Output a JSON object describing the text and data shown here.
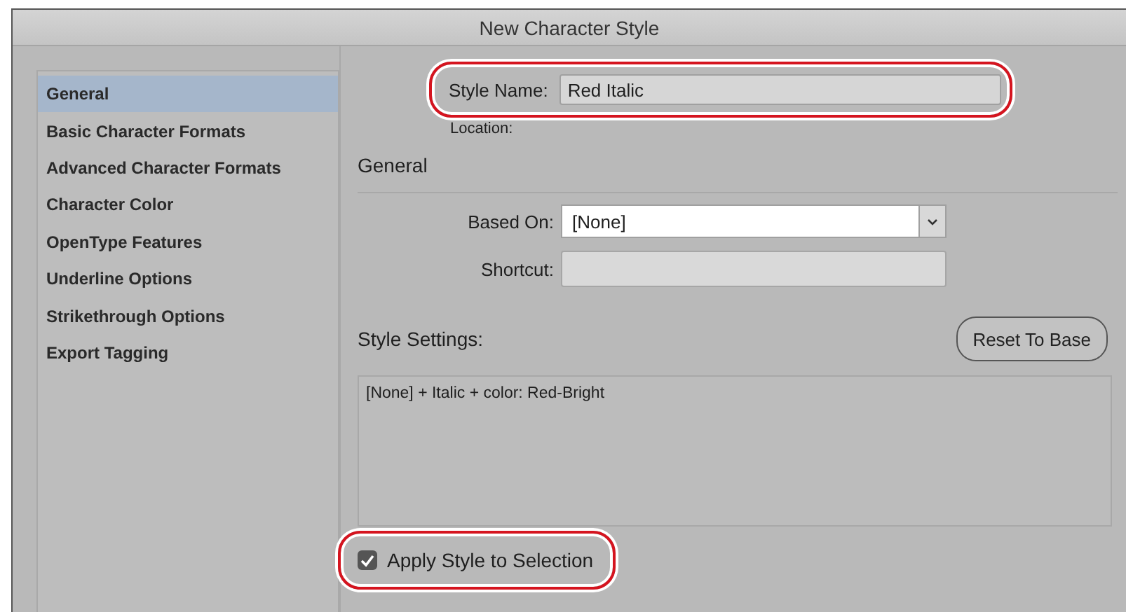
{
  "window": {
    "title": "New Character Style"
  },
  "sidebar": {
    "items": [
      {
        "label": "General",
        "selected": true
      },
      {
        "label": "Basic Character Formats",
        "selected": false
      },
      {
        "label": "Advanced Character Formats",
        "selected": false
      },
      {
        "label": "Character Color",
        "selected": false
      },
      {
        "label": "OpenType Features",
        "selected": false
      },
      {
        "label": "Underline Options",
        "selected": false
      },
      {
        "label": "Strikethrough Options",
        "selected": false
      },
      {
        "label": "Export Tagging",
        "selected": false
      }
    ]
  },
  "style_name": {
    "label": "Style Name:",
    "value": "Red Italic",
    "highlighted": true
  },
  "location": {
    "label": "Location:"
  },
  "section_title": "General",
  "based_on": {
    "label": "Based On:",
    "value": "[None]"
  },
  "shortcut": {
    "label": "Shortcut:"
  },
  "style_settings": {
    "label": "Style Settings:",
    "text": "[None] + Italic + color: Red-Bright"
  },
  "reset_button": "Reset To Base",
  "apply_checkbox": {
    "label": "Apply Style to Selection",
    "checked": true,
    "highlighted": true
  }
}
